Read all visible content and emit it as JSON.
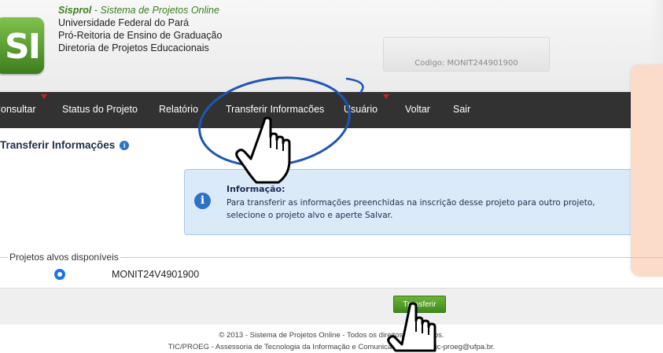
{
  "header": {
    "system_name": "Sisprol",
    "system_subtitle": " - Sistema de Projetos Online",
    "university": "Universidade Federal do Pará",
    "dept": "Pró-Reitoria de Ensino de Graduação",
    "directorate": "Diretoria de Projetos Educacionais",
    "logo_text": "SI",
    "code_label": "Codigo: MONIT244901900"
  },
  "nav": {
    "items": [
      {
        "label": "Consultar"
      },
      {
        "label": "Status do Projeto"
      },
      {
        "label": "Relatório"
      },
      {
        "label": "Transferir Informacões"
      },
      {
        "label": "Usuário"
      },
      {
        "label": "Voltar"
      },
      {
        "label": "Sair"
      }
    ]
  },
  "page": {
    "title": "Transferir Informações",
    "info_title": "Informação:",
    "info_message": "Para transferir as informações preenchidas na inscrição desse projeto para outro projeto, selecione o projeto alvo e aperte Salvar."
  },
  "projects": {
    "legend": "Projetos alvos disponíveis",
    "options": [
      {
        "label": "MONIT24V4901900",
        "selected": true
      }
    ]
  },
  "actions": {
    "transfer_label": "Transferir"
  },
  "footer": {
    "line1": "© 2013 - Sistema de Projetos Online - Todos os direitos reservados.",
    "line2": "TIC/PROEG - Assessoria de Tecnologia da Informação e Comunicação. E-mail: tic-proeg@ufpa.br."
  },
  "colors": {
    "nav_bg": "#323232",
    "accent_green": "#4a9a22",
    "info_bg": "#dbeaf8",
    "annotation_blue": "#1f56b4",
    "menu_caret": "#d21f1f"
  }
}
